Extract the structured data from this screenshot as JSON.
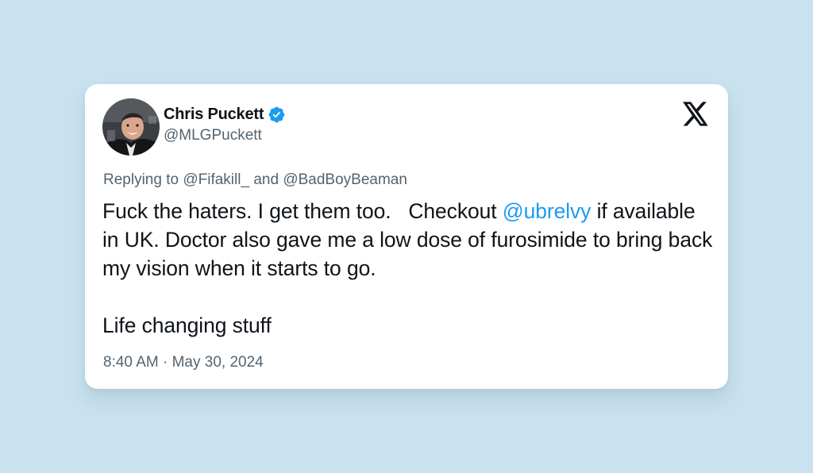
{
  "user": {
    "display_name": "Chris Puckett",
    "handle": "@MLGPuckett",
    "verified": true
  },
  "reply": {
    "prefix": "Replying to",
    "mentions": [
      "@Fifakill_",
      "@BadBoyBeaman"
    ],
    "joiner": "and"
  },
  "tweet": {
    "line1_before_mention": "Fuck the haters. I get them too.   Checkout ",
    "mention": "@ubrelvy",
    "line1_after_mention": " if available in UK. Doctor also gave me a low dose of furosimide to bring back my vision when it starts to go.",
    "line2": "Life changing stuff"
  },
  "timestamp": {
    "time": "8:40 AM",
    "separator": " · ",
    "date": "May 30, 2024"
  },
  "icons": {
    "brand": "x-logo-icon",
    "verified": "verified-badge-icon"
  },
  "colors": {
    "background": "#c9e2ef",
    "card": "#ffffff",
    "link": "#1d9bf0",
    "verified": "#1d9bf0",
    "text_primary": "#0f1419",
    "text_secondary": "#536471"
  }
}
